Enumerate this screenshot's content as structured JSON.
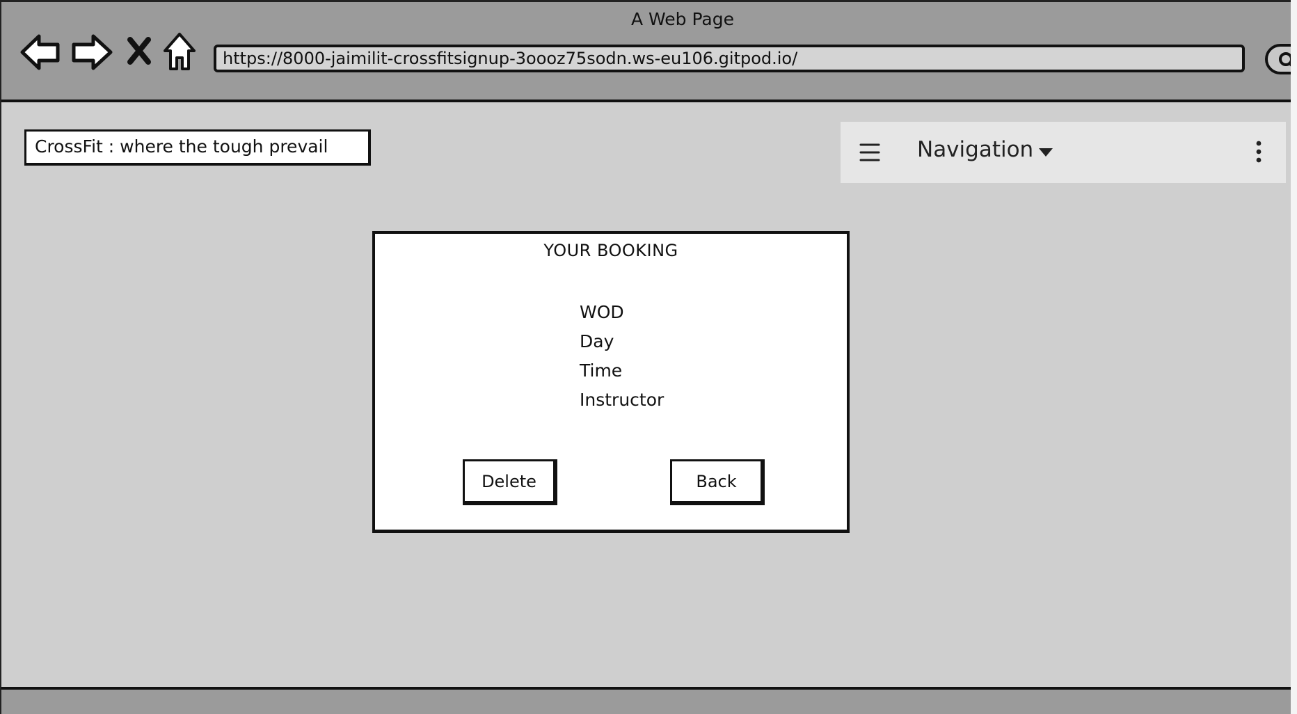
{
  "window": {
    "title": "A Web Page"
  },
  "browser": {
    "url": "https://8000-jaimilit-crossfitsignup-3oooz75sodn.ws-eu106.gitpod.io/",
    "icons": [
      "back-arrow-icon",
      "forward-arrow-icon",
      "stop-icon",
      "home-icon",
      "search-icon"
    ]
  },
  "header": {
    "tagline": "CrossFit : where the tough prevail"
  },
  "navbar": {
    "label": "Navigation",
    "icons": [
      "hamburger-menu-icon",
      "caret-down-icon",
      "kebab-menu-icon"
    ]
  },
  "booking": {
    "title": "YOUR BOOKING",
    "details": [
      "WOD",
      "Day",
      "Time",
      "Instructor"
    ],
    "delete_label": "Delete",
    "back_label": "Back"
  },
  "colors": {
    "chrome": "#9b9b9b",
    "page_background": "#cfcfcf",
    "navbar_background": "#e6e6e6",
    "panel_background": "#ffffff",
    "ink": "#111111"
  }
}
